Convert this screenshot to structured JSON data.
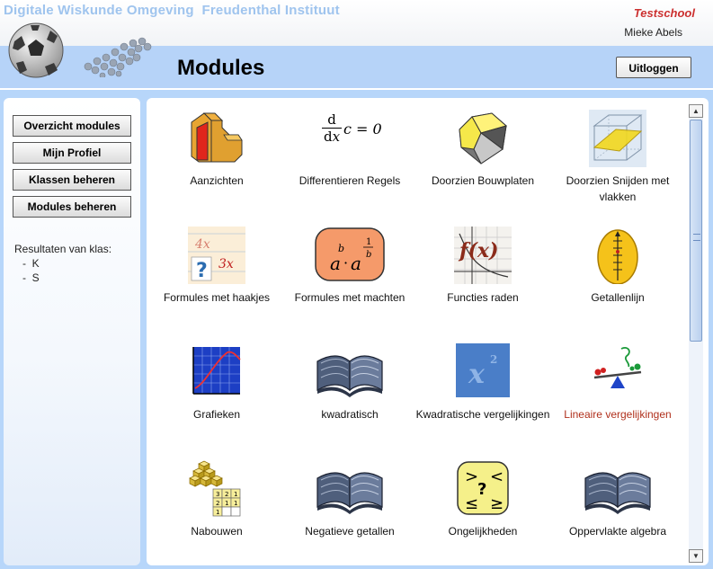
{
  "header": {
    "site_title": "Digitale Wiskunde Omgeving  Freudenthal Instituut",
    "school": "Testschool",
    "user_name": "Mieke Abels",
    "page_title": "Modules",
    "logout_label": "Uitloggen"
  },
  "sidebar": {
    "buttons": [
      "Overzicht modules",
      "Mijn Profiel",
      "Klassen beheren",
      "Modules beheren"
    ],
    "results_label": "Resultaten van klas:",
    "classes": [
      "-  K",
      "-  S"
    ]
  },
  "modules": [
    {
      "label": "Aanzichten",
      "icon": "blocks-icon"
    },
    {
      "label": "Differentieren Regels",
      "icon": "derivative-formula-icon",
      "formula": "c = 0"
    },
    {
      "label": "Doorzien Bouwplaten",
      "icon": "polyhedron-icon"
    },
    {
      "label": "Doorzien Snijden met vlakken",
      "icon": "cube-plane-icon"
    },
    {
      "label": "Formules met haakjes",
      "icon": "formula-brackets-icon",
      "text_a": "4x",
      "text_b": "3x"
    },
    {
      "label": "Formules met machten",
      "icon": "powers-icon"
    },
    {
      "label": "Functies raden",
      "icon": "function-guess-icon",
      "text": "f(x)"
    },
    {
      "label": "Getallenlijn",
      "icon": "number-line-icon"
    },
    {
      "label": "Grafieken",
      "icon": "graph-icon"
    },
    {
      "label": "kwadratisch",
      "icon": "open-book-icon"
    },
    {
      "label": "Kwadratische vergelijkingen",
      "icon": "x-squared-icon"
    },
    {
      "label": "Lineaire vergelijkingen",
      "icon": "seesaw-icon",
      "highlight": true
    },
    {
      "label": "Nabouwen",
      "icon": "cube-stack-icon"
    },
    {
      "label": "Negatieve getallen",
      "icon": "open-book-icon"
    },
    {
      "label": "Ongelijkheden",
      "icon": "inequalities-icon"
    },
    {
      "label": "Oppervlakte algebra",
      "icon": "open-book-icon"
    }
  ],
  "colors": {
    "header_blue": "#b6d3f8",
    "title_blue": "#9fc4ee",
    "school_red": "#cc3030",
    "link_red": "#b0301c"
  }
}
